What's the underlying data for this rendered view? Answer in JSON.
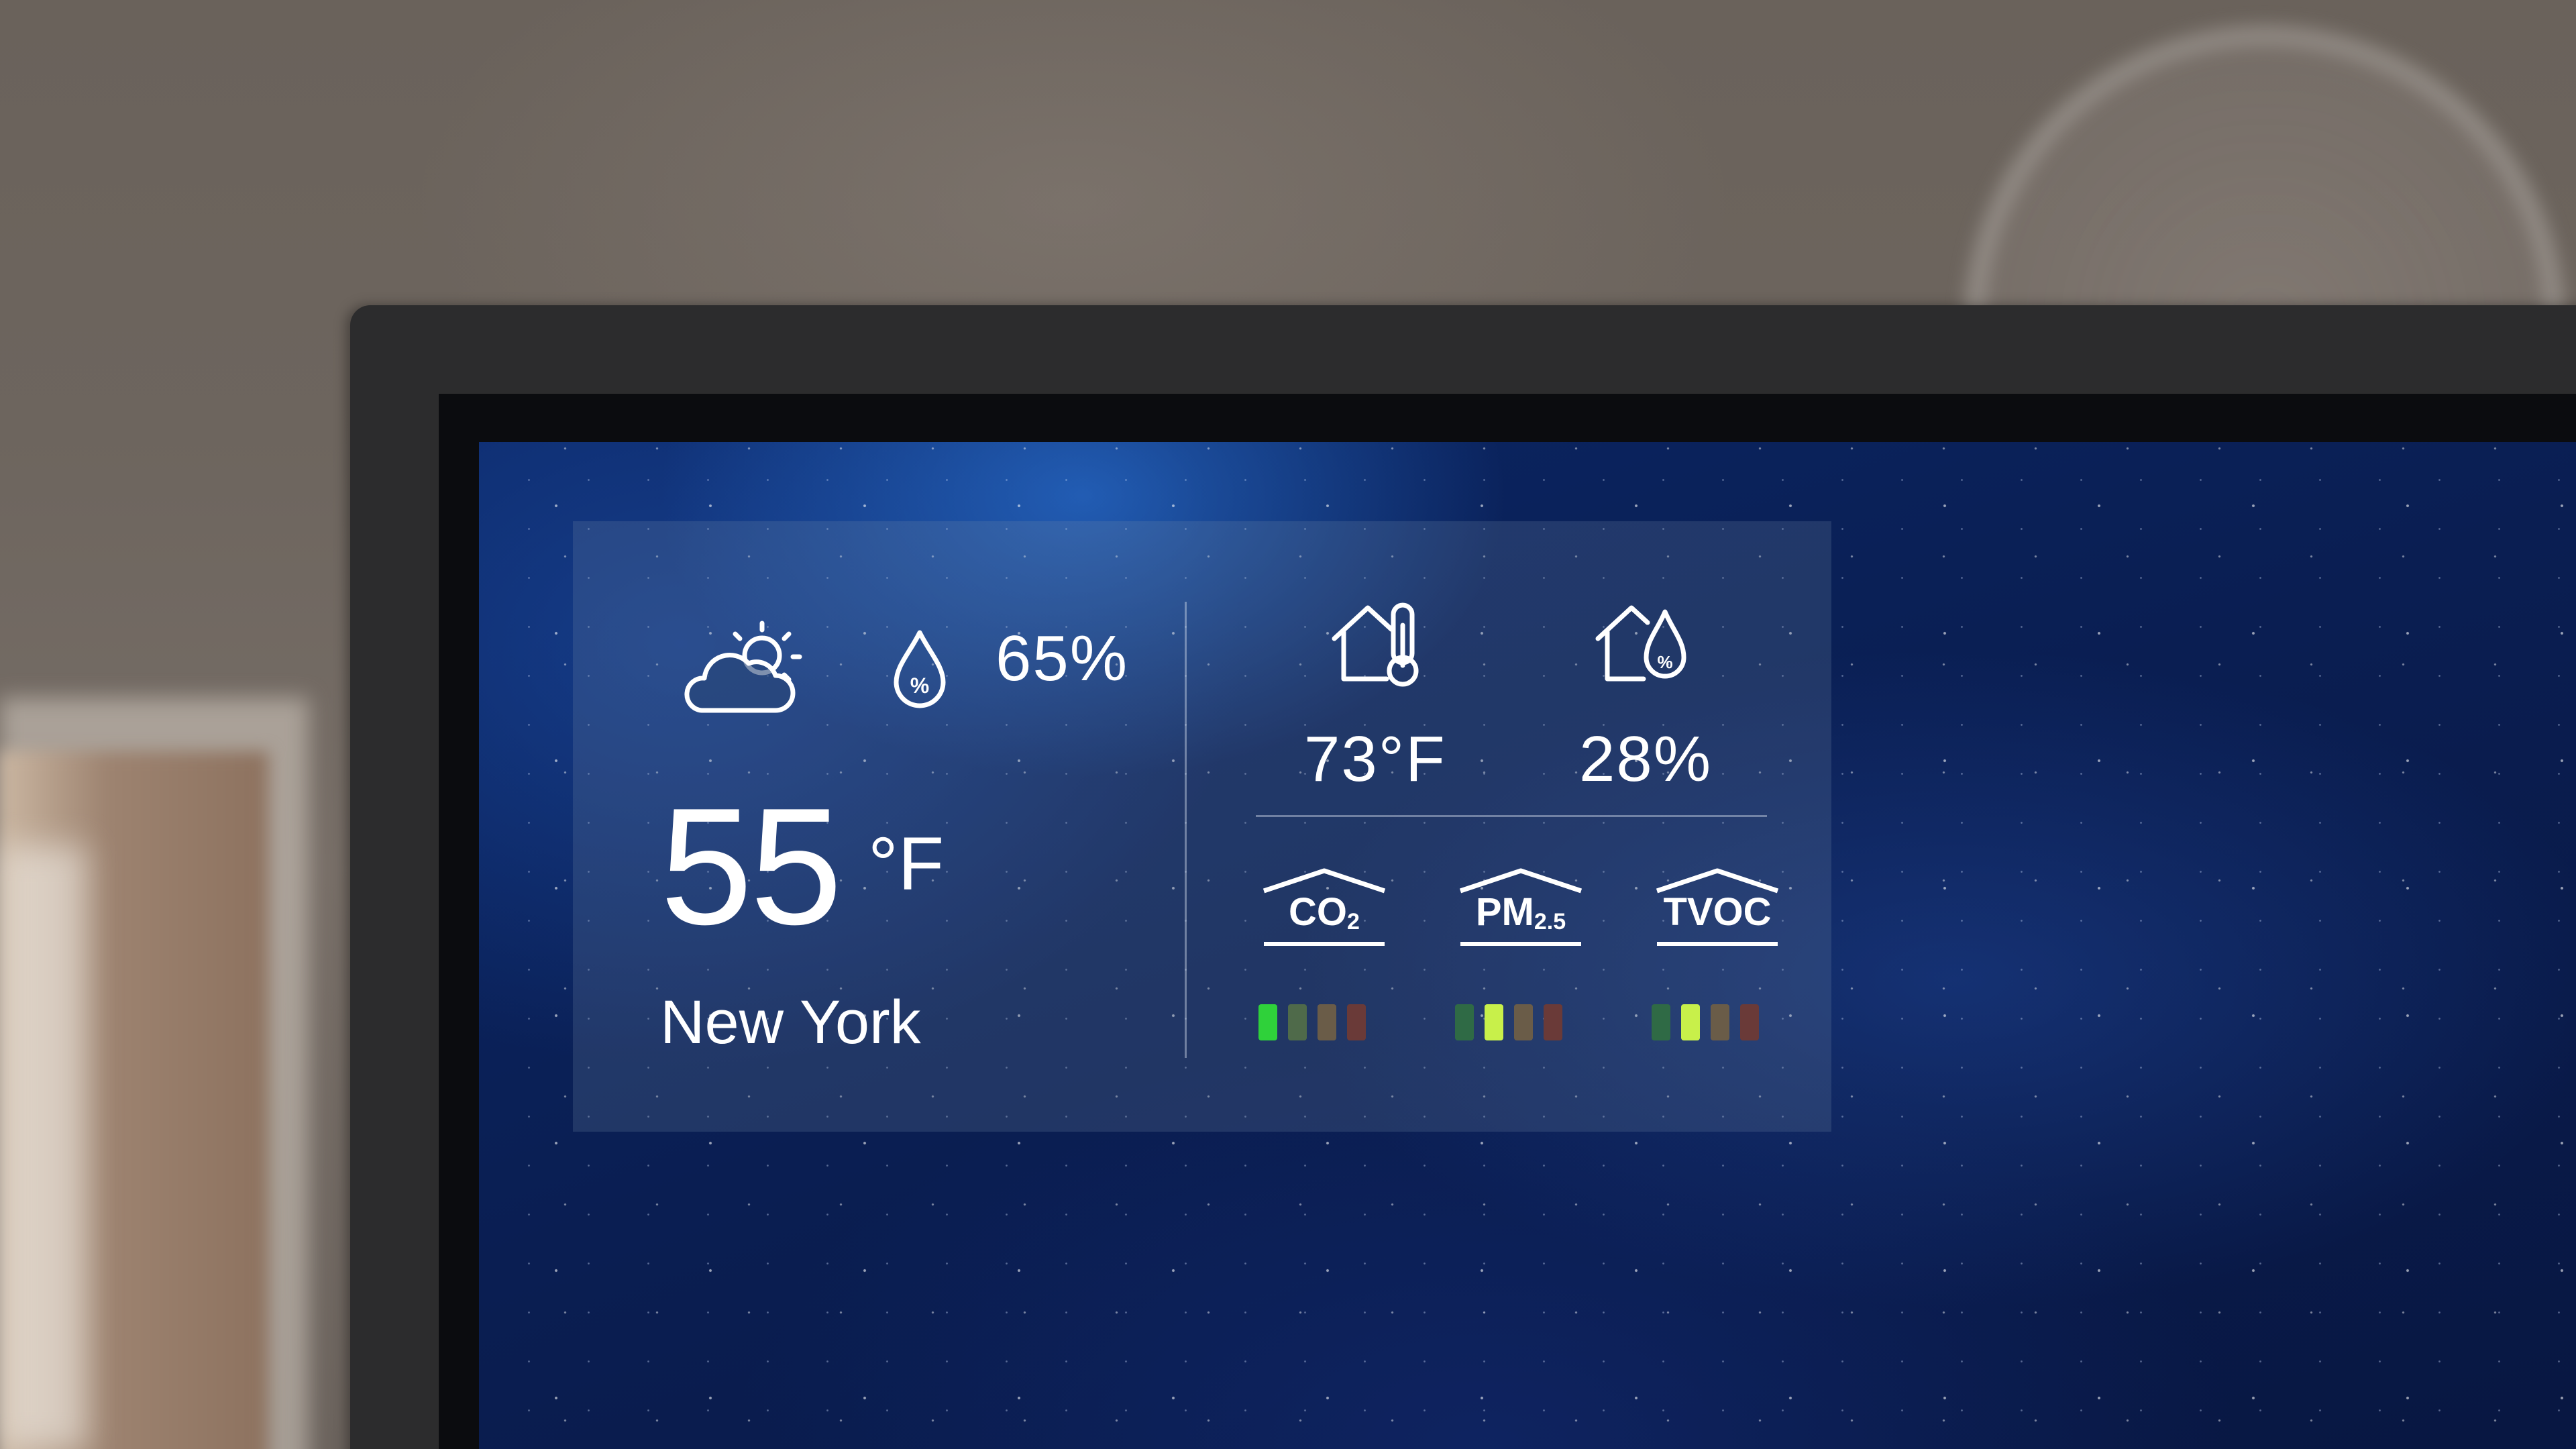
{
  "outdoor": {
    "weather_icon": "partly-cloudy-icon",
    "humidity_icon": "humidity-drop-icon",
    "humidity": "65%",
    "temperature": "55",
    "temperature_unit": "°F",
    "city": "New York"
  },
  "indoor": {
    "temperature_icon": "home-thermometer-icon",
    "humidity_icon": "home-humidity-icon",
    "temperature": "73°F",
    "humidity": "28%"
  },
  "air_quality": [
    {
      "label": "CO",
      "sub": "2",
      "icon": "co2-house-icon",
      "level_index": 0
    },
    {
      "label": "PM",
      "sub": "2.5",
      "icon": "pm25-house-icon",
      "level_index": 1
    },
    {
      "label": "TVOC",
      "sub": "",
      "icon": "tvoc-house-icon",
      "level_index": 1
    }
  ],
  "level_colors": {
    "active": [
      "#2fd13a",
      "#c8f04a",
      "#c89b3a",
      "#e0503a"
    ],
    "inactive": [
      "#2f6a45",
      "#4f6a4a",
      "#6a5c48",
      "#6a3a38"
    ]
  }
}
